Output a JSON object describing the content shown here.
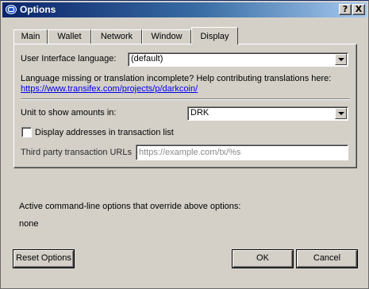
{
  "window": {
    "title": "Options",
    "help_label": "?",
    "close_label": "X"
  },
  "tabs": [
    {
      "label": "Main"
    },
    {
      "label": "Wallet"
    },
    {
      "label": "Network"
    },
    {
      "label": "Window"
    },
    {
      "label": "Display",
      "active": true
    }
  ],
  "display": {
    "language_label": "User Interface language:",
    "language_value": "(default)",
    "translation_note": "Language missing or translation incomplete? Help contributing translations here:",
    "translation_link": "https://www.transifex.com/projects/p/darkcoin/",
    "unit_label": "Unit to show amounts in:",
    "unit_value": "DRK",
    "show_addresses_label": "Display addresses in transaction list",
    "show_addresses_checked": false,
    "third_party_label": "Third party transaction URLs",
    "third_party_placeholder": "https://example.com/tx/%s",
    "third_party_value": ""
  },
  "overrides": {
    "label": "Active command-line options that override above options:",
    "value": "none"
  },
  "buttons": {
    "reset": "Reset Options",
    "ok": "OK",
    "cancel": "Cancel"
  }
}
